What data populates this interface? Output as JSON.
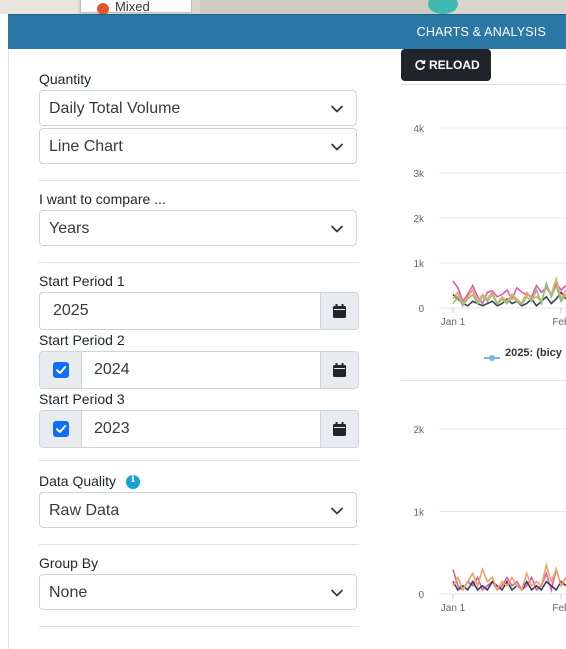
{
  "map": {
    "popup_label": "Mixed"
  },
  "header": {
    "title": "CHARTS & ANALYSIS"
  },
  "form": {
    "quantity_label": "Quantity",
    "quantity_value": "Daily Total Volume",
    "chart_type_value": "Line Chart",
    "compare_label": "I want to compare ...",
    "compare_value": "Years",
    "start1_label": "Start Period 1",
    "start1_value": "2025",
    "start2_label": "Start Period 2",
    "start2_value": "2024",
    "start2_checked": true,
    "start3_label": "Start Period 3",
    "start3_value": "2023",
    "start3_checked": true,
    "quality_label": "Data Quality",
    "quality_value": "Raw Data",
    "groupby_label": "Group By",
    "groupby_value": "None"
  },
  "toolbar": {
    "reload_label": "RELOAD"
  },
  "colors": {
    "header": "#2b77a6",
    "checkbox": "#0d6efd",
    "info": "#17a2d6",
    "series": [
      "#e05bb0",
      "#3a3f51",
      "#f4a261",
      "#8ec07c",
      "#e8a3c9",
      "#c39bd3"
    ]
  },
  "chart_data": [
    {
      "type": "line",
      "title": "",
      "ylim": [
        0,
        4000
      ],
      "yticks": [
        "4k",
        "3k",
        "2k",
        "1k",
        "0"
      ],
      "xticks": [
        "Jan 1",
        "Feb"
      ],
      "legend": [
        "2025: (bicy"
      ],
      "series": [
        {
          "values": [
            600,
            450,
            150,
            300,
            500,
            250,
            100,
            350,
            380,
            250,
            300,
            400,
            200,
            450,
            350,
            300,
            250,
            500,
            350,
            450,
            300,
            550,
            400,
            500
          ]
        },
        {
          "values": [
            300,
            200,
            100,
            50,
            150,
            100,
            50,
            100,
            150,
            50,
            100,
            200,
            100,
            150,
            50,
            100,
            200,
            50,
            150,
            250,
            100,
            200,
            350,
            200
          ]
        },
        {
          "values": [
            200,
            350,
            100,
            250,
            400,
            150,
            300,
            200,
            350,
            100,
            250,
            150,
            300,
            200,
            100,
            350,
            200,
            250,
            150,
            500,
            300,
            650,
            200,
            400
          ]
        },
        {
          "values": [
            100,
            250,
            50,
            200,
            300,
            100,
            250,
            150,
            300,
            80,
            200,
            100,
            250,
            150,
            80,
            250,
            150,
            400,
            100,
            550,
            250,
            500,
            150,
            300
          ]
        }
      ]
    },
    {
      "type": "line",
      "title": "",
      "ylim": [
        0,
        2000
      ],
      "yticks": [
        "2k",
        "1k",
        "0"
      ],
      "xticks": [
        "Jan 1",
        "Feb"
      ],
      "series": [
        {
          "values": [
            300,
            100,
            50,
            150,
            100,
            200,
            50,
            100,
            150,
            50,
            100,
            200,
            100,
            150,
            50,
            100,
            200,
            50,
            100,
            250,
            50,
            300,
            100,
            200
          ]
        },
        {
          "values": [
            150,
            50,
            100,
            50,
            150,
            50,
            100,
            50,
            150,
            100,
            50,
            150,
            50,
            100,
            50,
            150,
            50,
            100,
            50,
            150,
            100,
            50,
            150,
            100
          ]
        },
        {
          "values": [
            100,
            200,
            50,
            150,
            250,
            100,
            300,
            150,
            200,
            50,
            150,
            100,
            200,
            100,
            50,
            250,
            100,
            150,
            100,
            350,
            150,
            300,
            100,
            200
          ]
        }
      ]
    }
  ]
}
